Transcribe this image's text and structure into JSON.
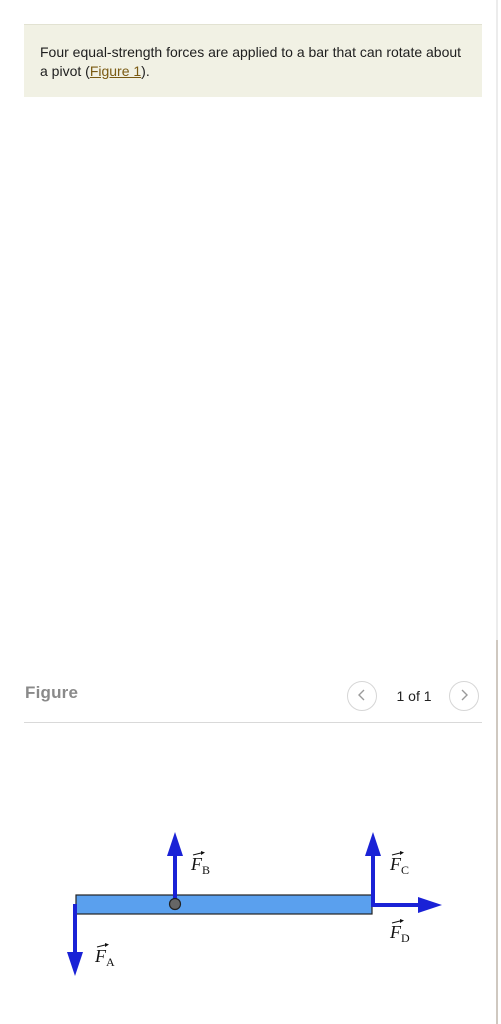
{
  "problem": {
    "text_before": "Four equal-strength forces are applied to a bar that can rotate about a pivot (",
    "link_text": "Figure 1",
    "text_after": ")."
  },
  "figure_panel": {
    "title": "Figure",
    "page_indicator": "1 of 1",
    "prev_icon": "chevron-left-icon",
    "next_icon": "chevron-right-icon"
  },
  "diagram": {
    "bar_color": "#5aa0ee",
    "arrow_color": "#1a22d6",
    "forces": [
      {
        "symbol": "F",
        "subscript": "A",
        "direction": "down"
      },
      {
        "symbol": "F",
        "subscript": "B",
        "direction": "up"
      },
      {
        "symbol": "F",
        "subscript": "C",
        "direction": "up"
      },
      {
        "symbol": "F",
        "subscript": "D",
        "direction": "right"
      }
    ]
  }
}
